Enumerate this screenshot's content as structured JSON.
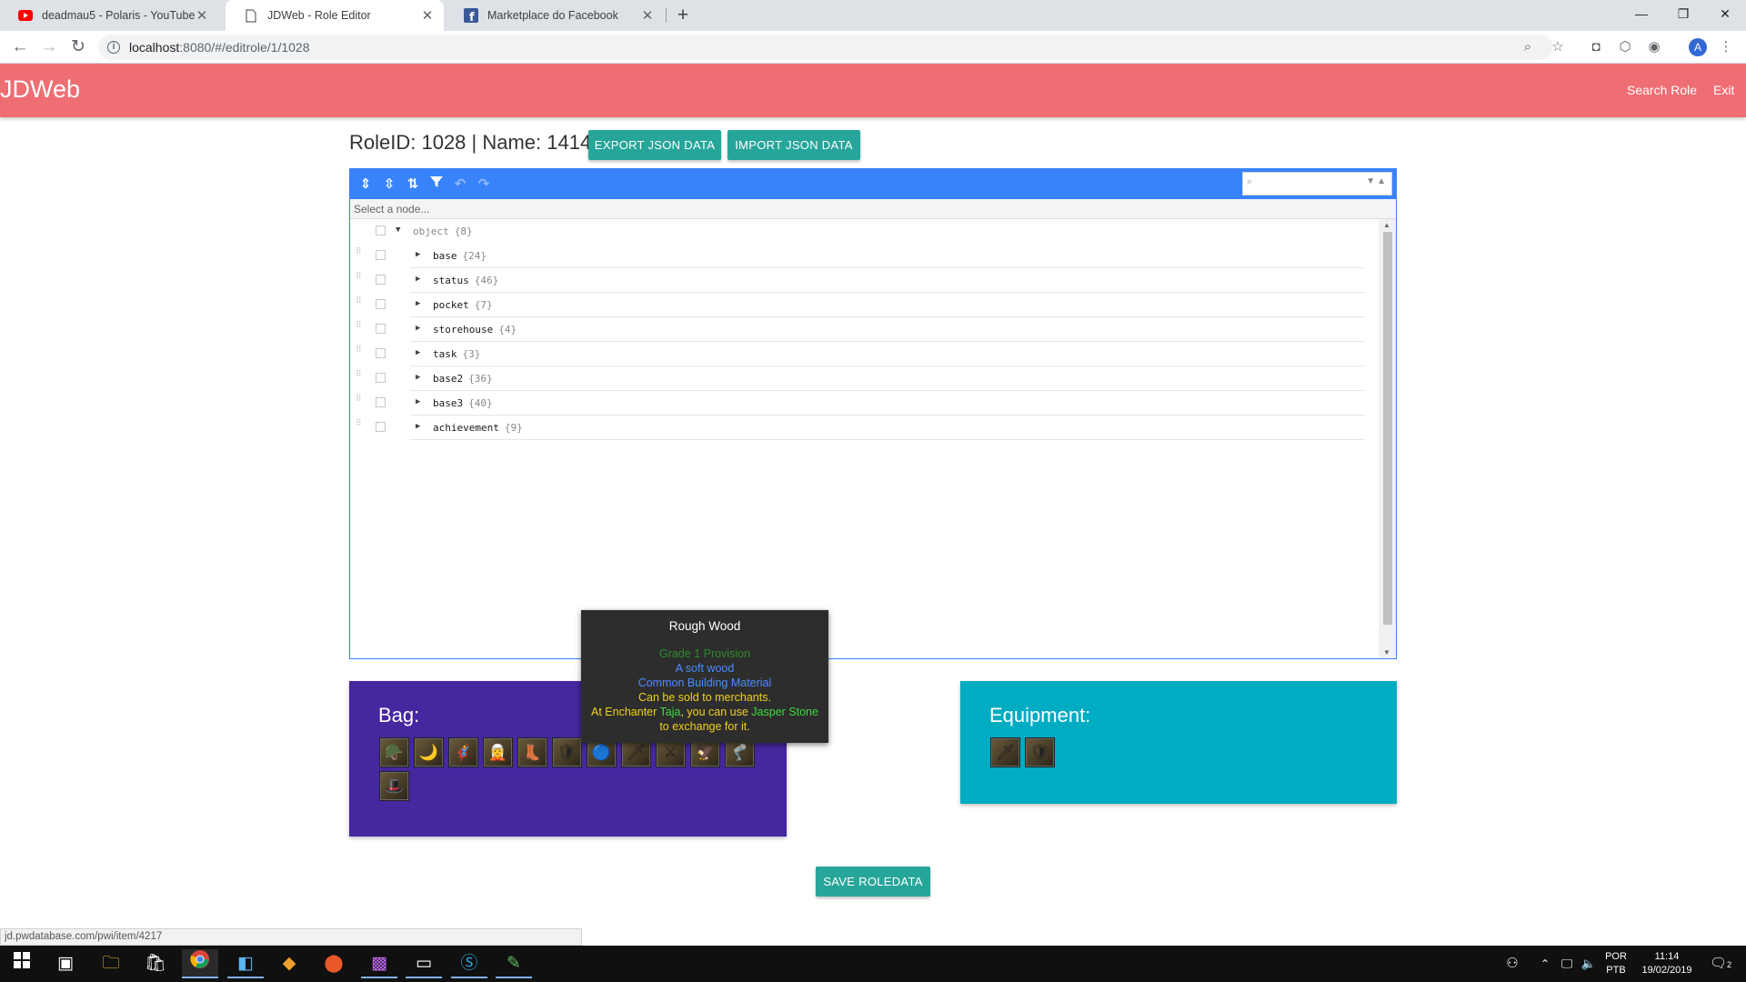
{
  "browser": {
    "tabs": [
      {
        "title": "deadmau5 - Polaris - YouTube",
        "icon": "youtube-icon",
        "active": false
      },
      {
        "title": "JDWeb - Role Editor",
        "icon": "page-icon",
        "active": true
      },
      {
        "title": "Marketplace do Facebook",
        "icon": "facebook-icon",
        "active": false
      }
    ],
    "url_host": "localhost",
    "url_path": ":8080/#/editrole/1/1028",
    "profile_initial": "A"
  },
  "app": {
    "brand": "JDWeb",
    "nav": {
      "search_role": "Search Role",
      "exit": "Exit"
    },
    "accent_color": "#ee6e73"
  },
  "header": {
    "role_heading": "RoleID: 1028 | Name: 1414",
    "export_label": "EXPORT JSON DATA",
    "import_label": "IMPORT JSON DATA"
  },
  "editor": {
    "nav_text": "Select a node...",
    "search_placeholder": "",
    "root": {
      "label": "object",
      "count": "{8}"
    },
    "nodes": [
      {
        "label": "base",
        "count": "{24}"
      },
      {
        "label": "status",
        "count": "{46}"
      },
      {
        "label": "pocket",
        "count": "{7}"
      },
      {
        "label": "storehouse",
        "count": "{4}"
      },
      {
        "label": "task",
        "count": "{3}"
      },
      {
        "label": "base2",
        "count": "{36}"
      },
      {
        "label": "base3",
        "count": "{40}"
      },
      {
        "label": "achievement",
        "count": "{9}"
      }
    ]
  },
  "bag": {
    "title": "Bag:",
    "color": "#4527a0",
    "items": [
      "🪖",
      "🌙",
      "🦸",
      "🧝",
      "👢",
      "🛡",
      "🔵",
      "🗡",
      "⚔",
      "🦅",
      "🦿",
      "🎩"
    ]
  },
  "equipment": {
    "title": "Equipment:",
    "color": "#00acc1",
    "items": [
      "🗡",
      "🛡"
    ]
  },
  "tooltip": {
    "title": "Rough Wood",
    "grade": "Grade 1 Provision",
    "desc": "A soft wood",
    "type": "Common Building Material",
    "sell": "Can be sold to merchants.",
    "line_a": "At Enchanter ",
    "npc": "Taja",
    "line_b": ", you can use ",
    "stone": "Jasper Stone",
    "line_c": "to exchange for it."
  },
  "save_label": "SAVE ROLEDATA",
  "status_url": "jd.pwdatabase.com/pwi/item/4217",
  "taskbar": {
    "lang_top": "POR",
    "lang_bottom": "PTB",
    "time": "11:14",
    "date": "19/02/2019",
    "notifications": "2"
  }
}
